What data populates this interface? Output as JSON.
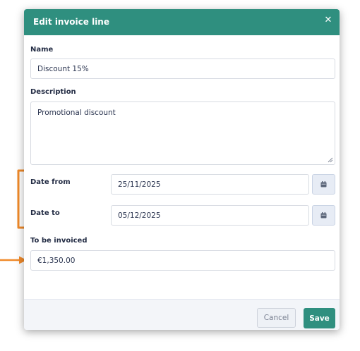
{
  "dialog": {
    "title": "Edit invoice line",
    "close_icon": "close-icon",
    "name_label": "Name",
    "name_value": "Discount 15%",
    "description_label": "Description",
    "description_value": "Promotional discount",
    "date_from_label": "Date from",
    "date_from_value": "25/11/2025",
    "date_to_label": "Date to",
    "date_to_value": "05/12/2025",
    "to_be_invoiced_label": "To be invoiced",
    "to_be_invoiced_value": "€1,350.00",
    "calendar_icon": "calendar-icon",
    "cancel_label": "Cancel",
    "save_label": "Save"
  },
  "colors": {
    "header": "#2f8f7f",
    "save_button": "#2f8f7f",
    "annotation": "#f08a2a"
  }
}
